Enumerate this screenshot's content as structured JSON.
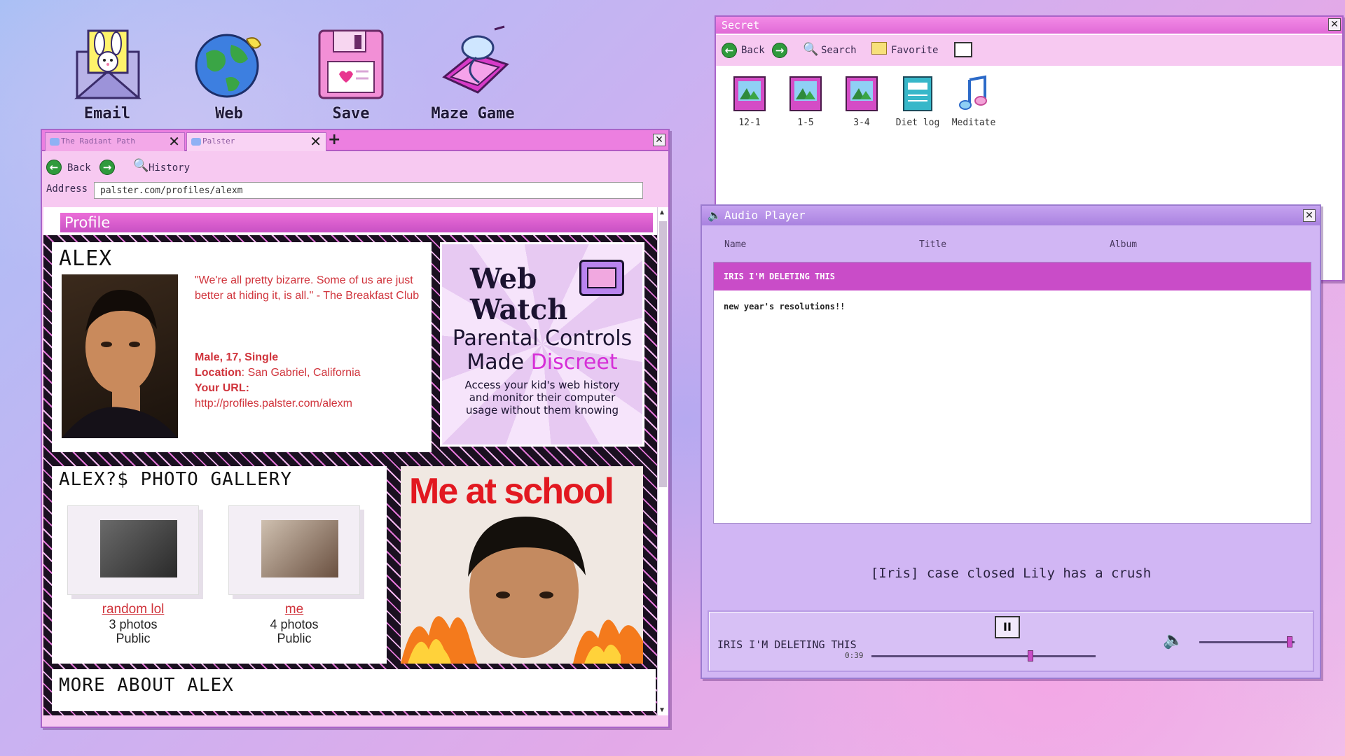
{
  "desktop": {
    "icons": [
      {
        "label": "Email",
        "icon": "email-bunny-icon"
      },
      {
        "label": "Web",
        "icon": "globe-icon"
      },
      {
        "label": "Save",
        "icon": "floppy-disk-icon"
      },
      {
        "label": "Maze Game",
        "icon": "maze-game-icon"
      }
    ]
  },
  "browser": {
    "tabs": [
      {
        "label": "The Radiant Path",
        "active": false
      },
      {
        "label": "Palster",
        "active": true
      }
    ],
    "new_tab": "+",
    "close": "✕",
    "nav": {
      "back": "Back",
      "history": "History"
    },
    "address_label": "Address",
    "address": "palster.com/profiles/alexm",
    "page": {
      "section_title": "Profile",
      "profile": {
        "name": "ALEX",
        "quote": "\"We're all pretty bizarre. Some of us are just better at hiding it, is all.\" - The Breakfast Club",
        "details": "Male, 17, Single",
        "location_label": "Location",
        "location": "San Gabriel, California",
        "url_label": "Your URL:",
        "url": "http://profiles.palster.com/alexm"
      },
      "ad": {
        "title_line1": "Web",
        "title_line2": "Watch",
        "headline1": "Parental Controls",
        "headline2a": "Made ",
        "headline2b": "Discreet",
        "body": "Access your kid's web history and monitor their computer usage without them knowing"
      },
      "gallery": {
        "title": "ALEX?$ PHOTO GALLERY",
        "albums": [
          {
            "name": "random lol",
            "count": "3 photos",
            "visibility": "Public"
          },
          {
            "name": "me",
            "count": "4 photos",
            "visibility": "Public"
          }
        ]
      },
      "school_photo": {
        "caption": "Me at school"
      },
      "more_title": "MORE ABOUT ALEX"
    }
  },
  "secret_window": {
    "title": "Secret",
    "close": "✕",
    "toolbar": {
      "back": "Back",
      "search": "Search",
      "favorite": "Favorite"
    },
    "files": [
      {
        "label": "12-1",
        "icon": "photo-album-icon"
      },
      {
        "label": "1-5",
        "icon": "photo-album-icon"
      },
      {
        "label": "3-4",
        "icon": "photo-album-icon"
      },
      {
        "label": "Diet log",
        "icon": "notebook-icon"
      },
      {
        "label": "Meditate",
        "icon": "music-note-icon"
      }
    ]
  },
  "audio_player": {
    "title": "Audio Player",
    "close": "✕",
    "columns": [
      "Name",
      "Title",
      "Album"
    ],
    "selected_track": "IRIS I'M DELETING THIS",
    "items": [
      "new year's resolutions!!"
    ],
    "lyric": "[Iris] case closed Lily has a crush",
    "now_playing": "IRIS I'M DELETING THIS",
    "elapsed": "0:39",
    "progress": 0.71,
    "volume": 0.95,
    "pause_symbol": "II"
  },
  "colors": {
    "accent": "#ec7fe0",
    "link_red": "#d0343c",
    "selection": "#c94cc8"
  }
}
